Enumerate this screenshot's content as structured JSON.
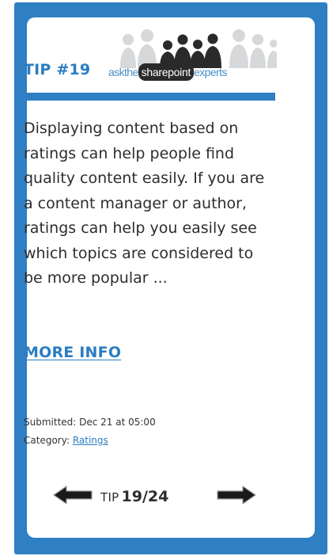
{
  "tip": {
    "title": "TIP #19",
    "brand": {
      "prefix": "askthe",
      "highlight": "sharepoint",
      "suffix": "experts"
    },
    "body": "Displaying content based on ratings can help people find quality content easily. If you are a content manager or author, ratings can help you easily see which topics are considered to be more popular ...",
    "more_info_label": "MORE INFO",
    "submitted": "Submitted: Dec 21 at 05:00",
    "category_label": "Category:",
    "category_value": "Ratings"
  },
  "pager": {
    "label": "TIP",
    "count": "19/24",
    "current": 19,
    "total": 24
  },
  "colors": {
    "frame": "#2f7fc4",
    "accent": "#2b7dc2",
    "text": "#2d2d2d"
  },
  "icons": {
    "prev": "arrow-left-icon",
    "next": "arrow-right-icon",
    "logo": "people-group-icon"
  }
}
